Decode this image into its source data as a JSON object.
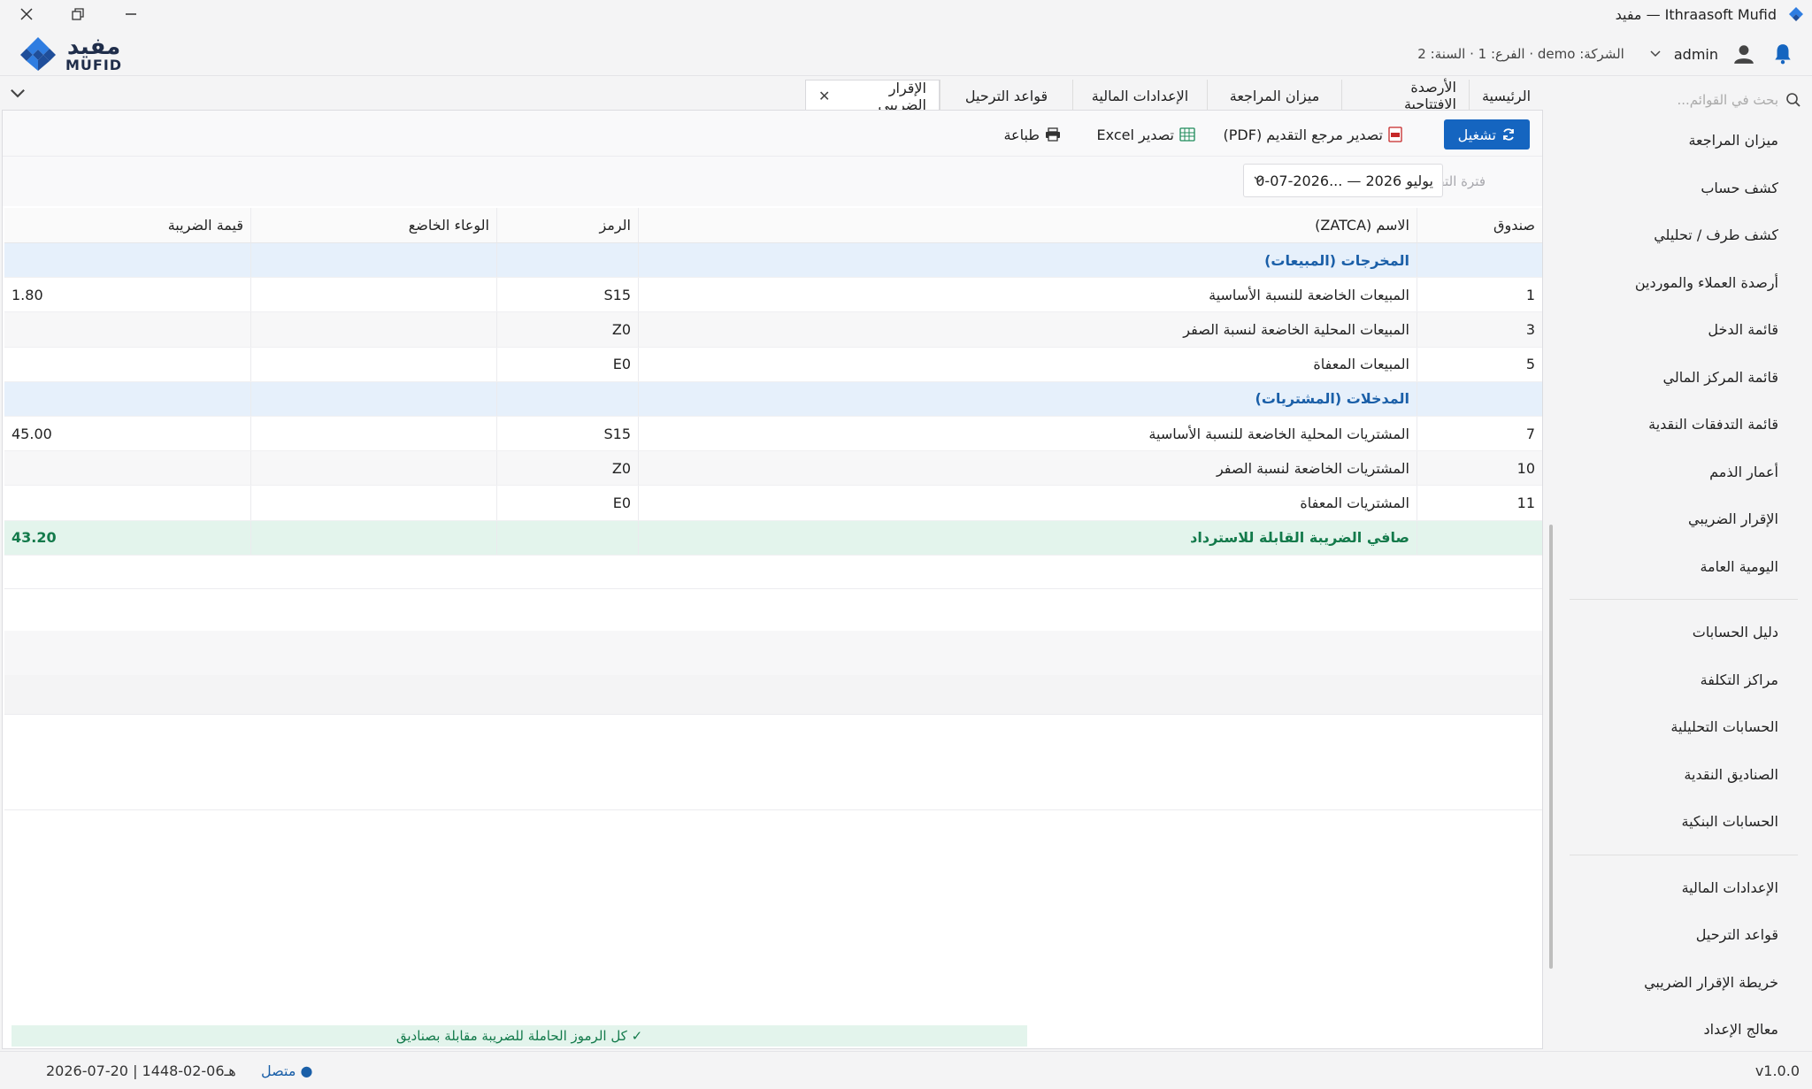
{
  "window": {
    "title": "Ithraasoft Mufid — مفيد"
  },
  "brand": {
    "ar": "مفيد",
    "en": "MUFID",
    "colors": {
      "primary": "#1f4e9a",
      "accent": "#2f7de1"
    }
  },
  "header": {
    "user": "admin",
    "context": "الشركة: demo · الفرع: 1 · السنة: 2"
  },
  "sidebar": {
    "search_placeholder": "بحث في القوائم...",
    "groups": [
      [
        "ميزان المراجعة",
        "كشف حساب",
        "كشف طرف / تحليلي",
        "أرصدة العملاء والموردين",
        "قائمة الدخل",
        "قائمة المركز المالي",
        "قائمة التدفقات النقدية",
        "أعمار الذمم",
        "الإقرار الضريبي",
        "اليومية العامة"
      ],
      [
        "دليل الحسابات",
        "مراكز التكلفة",
        "الحسابات التحليلية",
        "الصناديق النقدية",
        "الحسابات البنكية"
      ],
      [
        "الإعدادات المالية",
        "قواعد الترحيل",
        "خريطة الإقرار الضريبي",
        "معالج الإعداد"
      ]
    ]
  },
  "tabs": [
    {
      "label": "الرئيسية"
    },
    {
      "label": "الأرصدة الافتتاحية"
    },
    {
      "label": "ميزان المراجعة"
    },
    {
      "label": "الإعدادات المالية"
    },
    {
      "label": "قواعد الترحيل"
    },
    {
      "label": "الإقرار الضريبي",
      "active": true
    }
  ],
  "toolbar": {
    "run": "تشغيل",
    "export_pdf": "تصدير مرجع التقديم (PDF)",
    "export_excel": "تصدير Excel",
    "print": "طباعة"
  },
  "filter": {
    "label": "فترة التقديم",
    "value": "يوليو 2026 — ...2026-07-0"
  },
  "grid": {
    "columns": [
      "صندوق",
      "الاسم (ZATCA)",
      "الرمز",
      "الوعاء الخاضع",
      "قيمة الضريبة"
    ],
    "rows": [
      {
        "type": "section",
        "box": "",
        "name": "المخرجات (المبيعات)",
        "code": "",
        "base": "",
        "tax": ""
      },
      {
        "type": "normal",
        "box": "1",
        "name": "المبيعات الخاضعة للنسبة الأساسية",
        "code": "S15",
        "base": "",
        "tax": "1.80"
      },
      {
        "type": "alt",
        "box": "3",
        "name": "المبيعات المحلية الخاضعة لنسبة الصفر",
        "code": "Z0",
        "base": "",
        "tax": ""
      },
      {
        "type": "normal",
        "box": "5",
        "name": "المبيعات المعفاة",
        "code": "E0",
        "base": "",
        "tax": ""
      },
      {
        "type": "section",
        "box": "",
        "name": "المدخلات (المشتريات)",
        "code": "",
        "base": "",
        "tax": ""
      },
      {
        "type": "normal",
        "box": "7",
        "name": "المشتريات المحلية الخاضعة للنسبة الأساسية",
        "code": "S15",
        "base": "",
        "tax": "45.00"
      },
      {
        "type": "alt",
        "box": "10",
        "name": "المشتريات الخاضعة لنسبة الصفر",
        "code": "Z0",
        "base": "",
        "tax": ""
      },
      {
        "type": "normal",
        "box": "11",
        "name": "المشتريات المعفاة",
        "code": "E0",
        "base": "",
        "tax": ""
      },
      {
        "type": "total",
        "box": "",
        "name": "صافي الضريبة القابلة للاسترداد",
        "code": "",
        "base": "",
        "tax": "43.20"
      }
    ]
  },
  "check_note": "✓ كل الرموز الحاملة للضريبة مقابلة بصناديق",
  "status": {
    "date": "2026-07-20 | 1448-02-06هـ",
    "connection": "● متصل",
    "version": "v1.0.0"
  }
}
